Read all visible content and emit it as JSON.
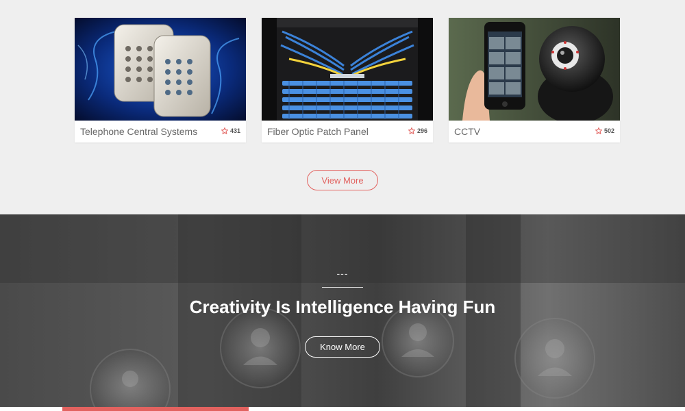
{
  "portfolio": {
    "items": [
      {
        "title": "Telephone Central Systems",
        "likes": "431",
        "image": "keypad-access-panels"
      },
      {
        "title": "Fiber Optic Patch Panel",
        "likes": "296",
        "image": "fiber-patch-panel-rack"
      },
      {
        "title": "CCTV",
        "likes": "502",
        "image": "cctv-camera-and-phone"
      }
    ],
    "view_more_label": "View More",
    "like_icon": "star-icon",
    "accent_color": "#e2625f"
  },
  "banner": {
    "dash": "---",
    "tagline": "Creativity Is Intelligence Having Fun",
    "know_more_label": "Know More"
  }
}
